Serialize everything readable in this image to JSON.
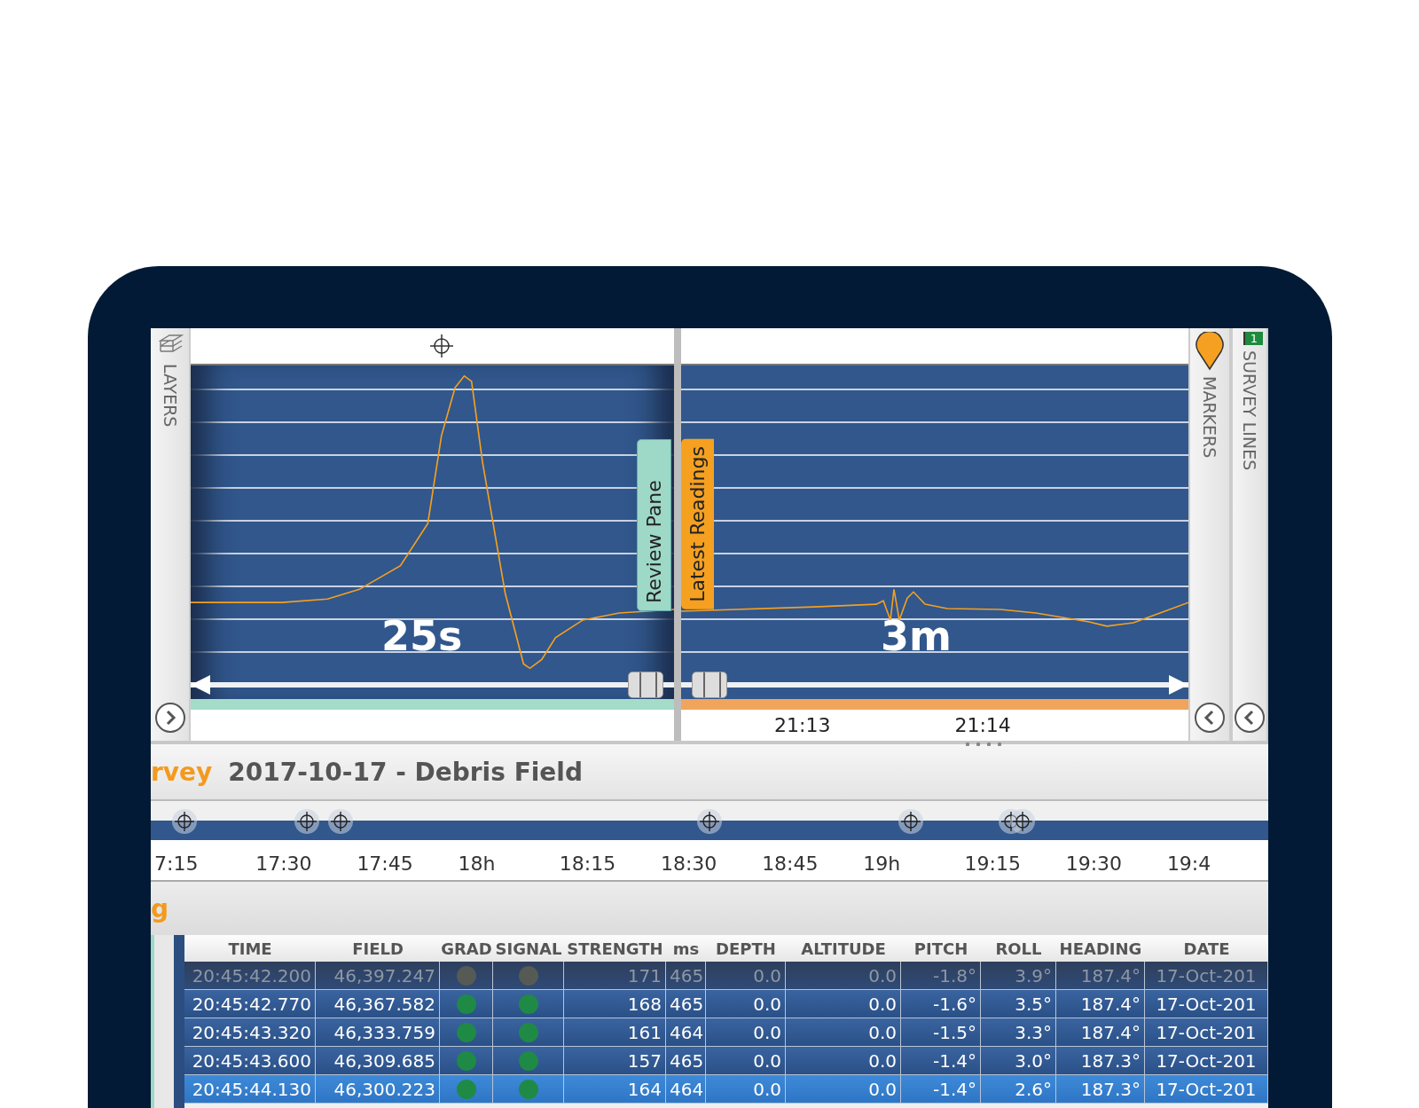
{
  "sidebar_left": {
    "label": "LAYERS"
  },
  "review_pane": {
    "tab": "Review Pane",
    "span": "25s",
    "slider": {
      "level": 1
    }
  },
  "latest_pane": {
    "tab": "Latest Readings",
    "span": "3m",
    "slider": {
      "level": 0
    },
    "time_labels": [
      "21:13",
      "21:14"
    ]
  },
  "sidebar_right": [
    {
      "kind": "markers",
      "label": "MARKERS"
    },
    {
      "kind": "lines",
      "label": "SURVEY LINES",
      "badge": "1"
    }
  ],
  "survey": {
    "prefix": "rvey",
    "title": "2017-10-17 - Debris Field"
  },
  "timeline": {
    "labels": [
      "7:15",
      "17:30",
      "17:45",
      "18h",
      "18:15",
      "18:30",
      "18:45",
      "19h",
      "19:15",
      "19:30",
      "19:4"
    ]
  },
  "section_label": "g",
  "table": {
    "columns": [
      "TIME",
      "FIELD",
      "GRAD",
      "SIGNAL",
      "STRENGTH",
      "ms",
      "DEPTH",
      "ALTITUDE",
      "PITCH",
      "ROLL",
      "HEADING",
      "DATE"
    ],
    "rows": [
      {
        "dimmed": true,
        "selected": false,
        "cells": [
          "20:45:42.200",
          "46,397.247",
          "",
          "",
          "171",
          "465",
          "0.0",
          "0.0",
          "-1.8°",
          "3.9°",
          "187.4°",
          "17-Oct-201"
        ]
      },
      {
        "dimmed": false,
        "selected": false,
        "cells": [
          "20:45:42.770",
          "46,367.582",
          "",
          "",
          "168",
          "465",
          "0.0",
          "0.0",
          "-1.6°",
          "3.5°",
          "187.4°",
          "17-Oct-201"
        ]
      },
      {
        "dimmed": false,
        "selected": false,
        "cells": [
          "20:45:43.320",
          "46,333.759",
          "",
          "",
          "161",
          "464",
          "0.0",
          "0.0",
          "-1.5°",
          "3.3°",
          "187.4°",
          "17-Oct-201"
        ]
      },
      {
        "dimmed": false,
        "selected": false,
        "cells": [
          "20:45:43.600",
          "46,309.685",
          "",
          "",
          "157",
          "465",
          "0.0",
          "0.0",
          "-1.4°",
          "3.0°",
          "187.3°",
          "17-Oct-201"
        ]
      },
      {
        "dimmed": false,
        "selected": true,
        "cells": [
          "20:45:44.130",
          "46,300.223",
          "",
          "",
          "164",
          "464",
          "0.0",
          "0.0",
          "-1.4°",
          "2.6°",
          "187.3°",
          "17-Oct-201"
        ]
      }
    ]
  }
}
